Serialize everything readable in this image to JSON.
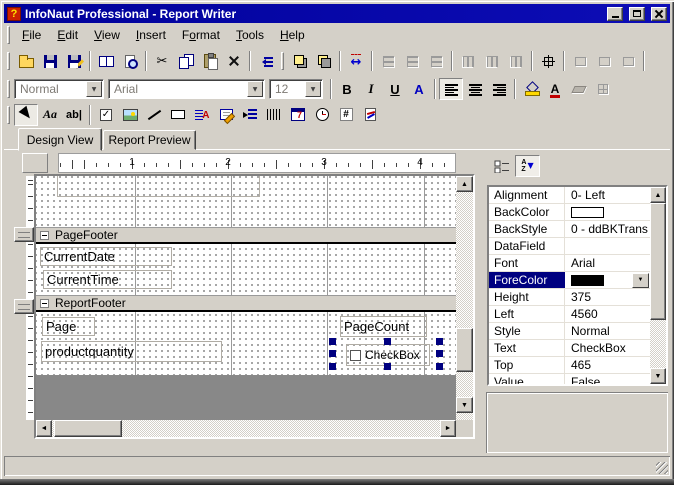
{
  "titlebar": {
    "title": "InfoNaut Professional - Report Writer"
  },
  "menu": {
    "items": [
      {
        "pre": "",
        "u": "F",
        "post": "ile"
      },
      {
        "pre": "",
        "u": "E",
        "post": "dit"
      },
      {
        "pre": "",
        "u": "V",
        "post": "iew"
      },
      {
        "pre": "",
        "u": "I",
        "post": "nsert"
      },
      {
        "pre": "F",
        "u": "o",
        "post": "rmat"
      },
      {
        "pre": "",
        "u": "T",
        "post": "ools"
      },
      {
        "pre": "",
        "u": "H",
        "post": "elp"
      }
    ]
  },
  "format_bar": {
    "style": "Normal",
    "font": "Arial",
    "size": "12"
  },
  "glyphs": {
    "question": "?",
    "bold": "B",
    "italic": "I",
    "underline": "U",
    "font_color": "A",
    "label_tool": "Aa",
    "textbox_tool": "ab|",
    "check": "✓",
    "rtf_a": "A",
    "calendar_day": "7",
    "hash": "#",
    "sort_a": "A",
    "sort_z": "Z",
    "scissors": "✂",
    "fit": "↔",
    "arrow_down": "▼",
    "arrow_up": "▲",
    "arrow_left": "◄",
    "arrow_right": "►"
  },
  "tabs": {
    "items": [
      {
        "label": "Design View"
      },
      {
        "label": "Report Preview"
      }
    ]
  },
  "ruler": {
    "marks": [
      "1",
      "2",
      "3",
      "4"
    ]
  },
  "design": {
    "bands": [
      {
        "label": "PageFooter"
      },
      {
        "label": "ReportFooter"
      }
    ],
    "fields": {
      "current_date": "CurrentDate",
      "current_time": "CurrentTime",
      "page": "Page",
      "product_quantity": "productquantity",
      "page_count": "PageCount",
      "checkbox": "CheckBox"
    }
  },
  "properties": {
    "selected_row": "ForeColor",
    "rows": [
      {
        "name": "Alignment",
        "value": "0- Left"
      },
      {
        "name": "BackColor",
        "value": "",
        "swatch": "#ffffff"
      },
      {
        "name": "BackStyle",
        "value": "0 - ddBKTrans"
      },
      {
        "name": "DataField",
        "value": ""
      },
      {
        "name": "Font",
        "value": "Arial"
      },
      {
        "name": "ForeColor",
        "value": "",
        "swatch": "#000000"
      },
      {
        "name": "Height",
        "value": "375"
      },
      {
        "name": "Left",
        "value": "4560"
      },
      {
        "name": "Style",
        "value": "Normal"
      },
      {
        "name": "Text",
        "value": "CheckBox"
      },
      {
        "name": "Top",
        "value": "465"
      },
      {
        "name": "Value",
        "value": "False"
      }
    ]
  },
  "colors": {
    "titlebar": "#00019a",
    "face": "#d4d0c8",
    "selection": "#000080",
    "selection_handle": "#000080",
    "canvas_overflow": "#888888",
    "backcolor_swatch": "#ffffff",
    "forecolor_swatch": "#000000"
  }
}
